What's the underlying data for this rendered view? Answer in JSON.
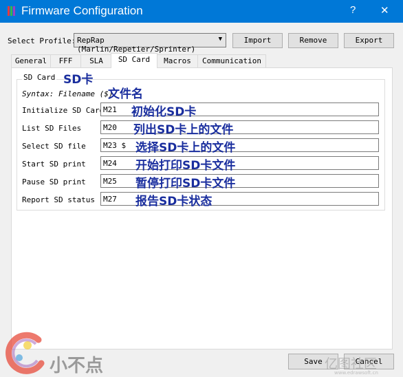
{
  "window": {
    "title": "Firmware Configuration",
    "help_label": "?",
    "close_label": "✕"
  },
  "profile": {
    "label": "Select Profile:",
    "selected": "RepRap (Marlin/Repetier/Sprinter)",
    "import_label": "Import",
    "remove_label": "Remove",
    "export_label": "Export"
  },
  "tabs": [
    {
      "label": "General"
    },
    {
      "label": "FFF"
    },
    {
      "label": "SLA"
    },
    {
      "label": "SD Card"
    },
    {
      "label": "Macros"
    },
    {
      "label": "Communication"
    }
  ],
  "active_tab": "SD Card",
  "sd_card": {
    "group_title": "SD Card",
    "group_annotation": "SD卡",
    "syntax": "Syntax: Filename ($)",
    "syntax_annotation": "文件名",
    "rows": [
      {
        "label": "Initialize SD Card",
        "value": "M21",
        "annotation": "初始化SD卡"
      },
      {
        "label": "List SD Files",
        "value": "M20",
        "annotation": "列出SD卡上的文件"
      },
      {
        "label": "Select SD file",
        "value": "M23 $",
        "annotation": "选择SD卡上的文件"
      },
      {
        "label": "Start SD print",
        "value": "M24",
        "annotation": "开始打印SD卡文件"
      },
      {
        "label": "Pause SD print",
        "value": "M25",
        "annotation": "暂停打印SD卡文件"
      },
      {
        "label": "Report SD status",
        "value": "M27",
        "annotation": "报告SD卡状态"
      }
    ]
  },
  "footer": {
    "save_label": "Save",
    "cancel_label": "Cancel"
  },
  "watermark": {
    "logo_text": "小不点",
    "site_text": "亿图社区",
    "site_sub": "www.edrawsoft.cn"
  },
  "colors": {
    "titlebar": "#0078d7",
    "annotation": "#1a2e9e"
  }
}
